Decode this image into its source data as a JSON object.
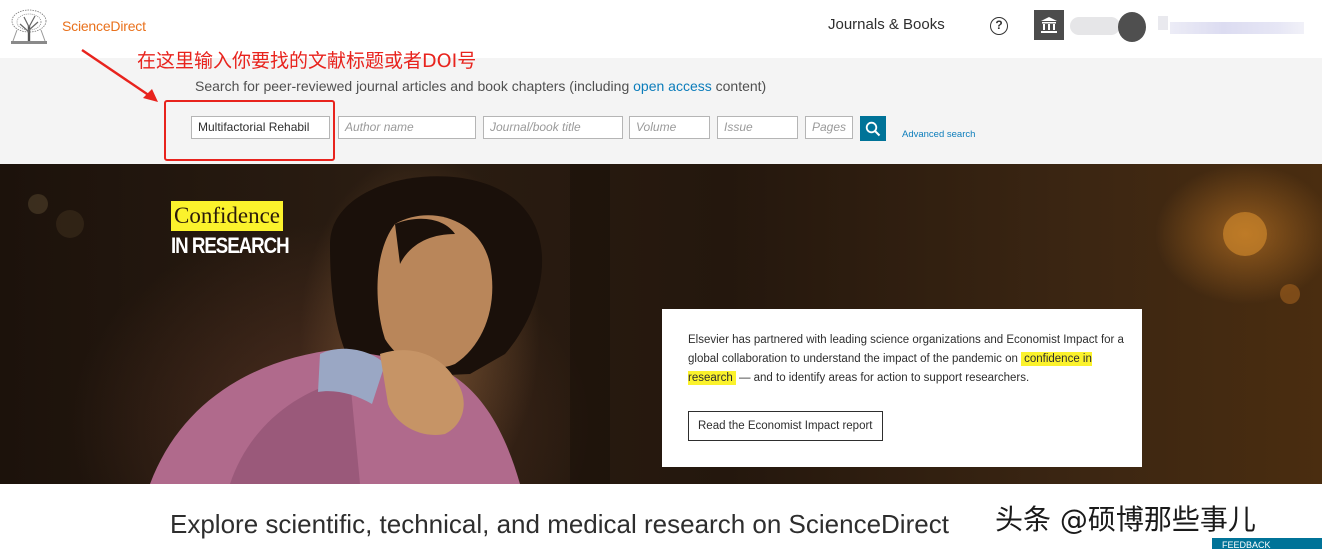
{
  "header": {
    "brand": "ScienceDirect",
    "nav_journals": "Journals & Books",
    "help_glyph": "?"
  },
  "annotation": {
    "text": "在这里输入你要找的文献标题或者DOI号",
    "color": "#e8231d"
  },
  "search": {
    "intro_before": "Search for peer-reviewed journal articles and book chapters (including ",
    "intro_link": "open access",
    "intro_after": " content)",
    "keywords_value": "Multifactorial Rehabil",
    "author_placeholder": "Author name",
    "journal_placeholder": "Journal/book title",
    "volume_placeholder": "Volume",
    "issue_placeholder": "Issue",
    "pages_placeholder": "Pages",
    "advanced_link": "Advanced search"
  },
  "hero": {
    "confidence_word": "Confidence",
    "confidence_sub": "IN RESEARCH",
    "card_before": "Elsevier has partnered with leading science organizations and Economist Impact for a global collaboration to understand the impact of the pandemic on ",
    "card_highlight": "confidence in research",
    "card_after": " — and to identify areas for action to support researchers.",
    "card_button": "Read the Economist Impact report"
  },
  "main": {
    "explore_heading": "Explore scientific, technical, and medical research on ScienceDirect"
  },
  "watermark": "头条 @硕博那些事儿",
  "feedback_label": "FEEDBACK",
  "colors": {
    "brand_orange": "#e9711c",
    "link_blue": "#0c7dbb",
    "search_button": "#007398",
    "highlight_yellow": "#fbf22c"
  },
  "icons": [
    "elsevier-tree-icon",
    "help-icon",
    "institution-icon",
    "search-icon",
    "arrow-icon"
  ]
}
